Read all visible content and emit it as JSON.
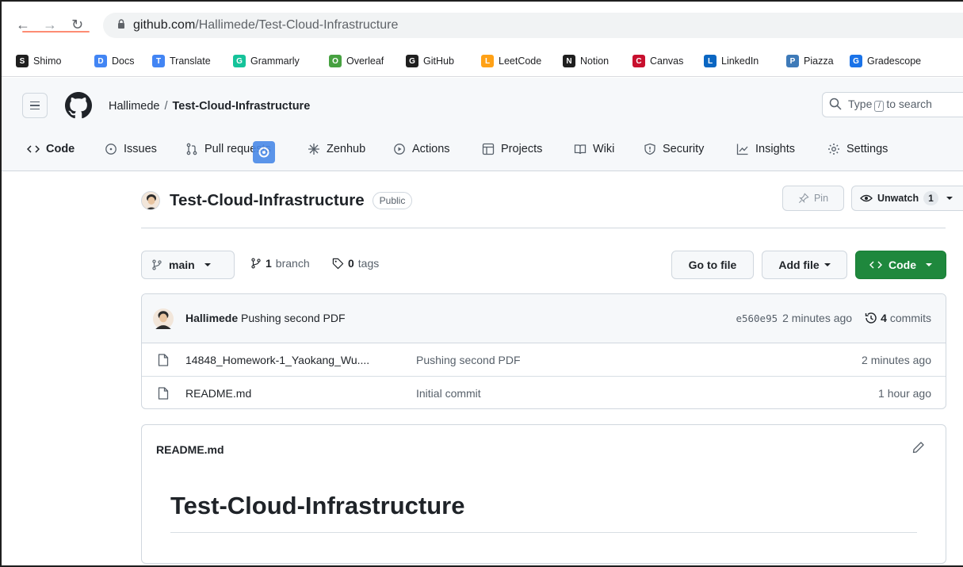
{
  "browser": {
    "url_host": "github.com",
    "url_path": "/Hallimede/Test-Cloud-Infrastructure",
    "bookmarks": [
      {
        "label": "Shimo",
        "icon": "shimo-icon",
        "color": "#1f1f1f"
      },
      {
        "label": "Docs",
        "icon": "docs-icon",
        "color": "#4285f4"
      },
      {
        "label": "Translate",
        "icon": "translate-icon",
        "color": "#4285f4"
      },
      {
        "label": "Grammarly",
        "icon": "grammarly-icon",
        "color": "#15c39a"
      },
      {
        "label": "Overleaf",
        "icon": "overleaf-icon",
        "color": "#47a141"
      },
      {
        "label": "GitHub",
        "icon": "github-icon",
        "color": "#1f1f1f"
      },
      {
        "label": "LeetCode",
        "icon": "leetcode-icon",
        "color": "#ffa116"
      },
      {
        "label": "Notion",
        "icon": "notion-icon",
        "color": "#1f1f1f"
      },
      {
        "label": "Canvas",
        "icon": "canvas-icon",
        "color": "#c8102e"
      },
      {
        "label": "LinkedIn",
        "icon": "linkedin-icon",
        "color": "#0a66c2"
      },
      {
        "label": "Piazza",
        "icon": "piazza-icon",
        "color": "#3e7ab8"
      },
      {
        "label": "Gradescope",
        "icon": "gradescope-icon",
        "color": "#1a73e8"
      }
    ]
  },
  "header": {
    "owner": "Hallimede",
    "separator": "/",
    "repo": "Test-Cloud-Infrastructure",
    "search_prefix": "Type",
    "search_key": "/",
    "search_suffix": "to search"
  },
  "tabs": [
    {
      "label": "Code",
      "icon": "code-icon",
      "active": true
    },
    {
      "label": "Issues",
      "icon": "issue-icon",
      "active": false
    },
    {
      "label": "Pull requests",
      "icon": "pull-request-icon",
      "active": false
    },
    {
      "label": "Zenhub",
      "icon": "zenhub-icon",
      "active": false
    },
    {
      "label": "Actions",
      "icon": "play-icon",
      "active": false
    },
    {
      "label": "Projects",
      "icon": "table-icon",
      "active": false
    },
    {
      "label": "Wiki",
      "icon": "book-icon",
      "active": false
    },
    {
      "label": "Security",
      "icon": "shield-icon",
      "active": false
    },
    {
      "label": "Insights",
      "icon": "graph-icon",
      "active": false
    },
    {
      "label": "Settings",
      "icon": "gear-icon",
      "active": false
    }
  ],
  "repo": {
    "name": "Test-Cloud-Infrastructure",
    "visibility": "Public",
    "pin_label": "Pin",
    "watch_label": "Unwatch",
    "watch_count": "1"
  },
  "toolbar": {
    "branch": "main",
    "branch_count": "1",
    "branch_word": "branch",
    "tag_count": "0",
    "tag_word": "tags",
    "goto_label": "Go to file",
    "addfile_label": "Add file",
    "code_label": "Code"
  },
  "latest_commit": {
    "author": "Hallimede",
    "message": "Pushing second PDF",
    "sha": "e560e95",
    "time": "2 minutes ago",
    "commit_count": "4",
    "commit_word": "commits"
  },
  "files": [
    {
      "name": "14848_Homework-1_Yaokang_Wu....",
      "commit": "Pushing second PDF",
      "time": "2 minutes ago"
    },
    {
      "name": "README.md",
      "commit": "Initial commit",
      "time": "1 hour ago"
    }
  ],
  "readme": {
    "label": "README.md",
    "heading": "Test-Cloud-Infrastructure"
  },
  "colors": {
    "primary_button": "#1f883d",
    "active_tab_underline": "#fd8c73",
    "header_bg": "#f6f8fa",
    "border": "#d0d7de"
  }
}
